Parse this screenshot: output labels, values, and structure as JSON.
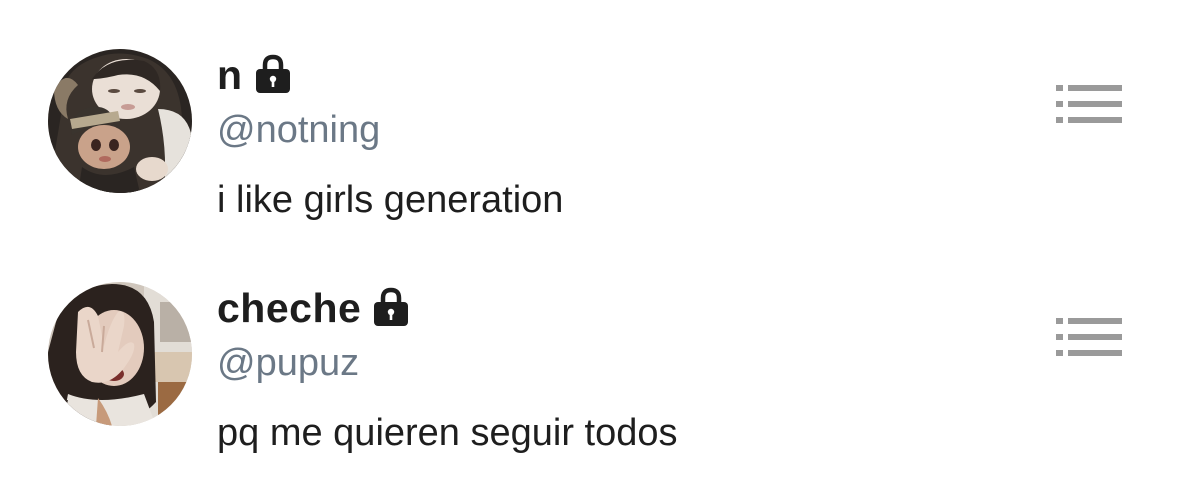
{
  "users": [
    {
      "display_name": "n",
      "handle": "@notning",
      "bio": "i like girls generation",
      "private_icon": "lock-icon",
      "menu_icon": "list-icon"
    },
    {
      "display_name": "cheche",
      "handle": "@pupuz",
      "bio": "pq me quieren seguir todos",
      "private_icon": "lock-icon",
      "menu_icon": "list-icon"
    }
  ],
  "colors": {
    "text_primary": "#1e1e1e",
    "text_secondary": "#6b7886",
    "icon_gray": "#9a9a9a",
    "background": "#ffffff"
  }
}
